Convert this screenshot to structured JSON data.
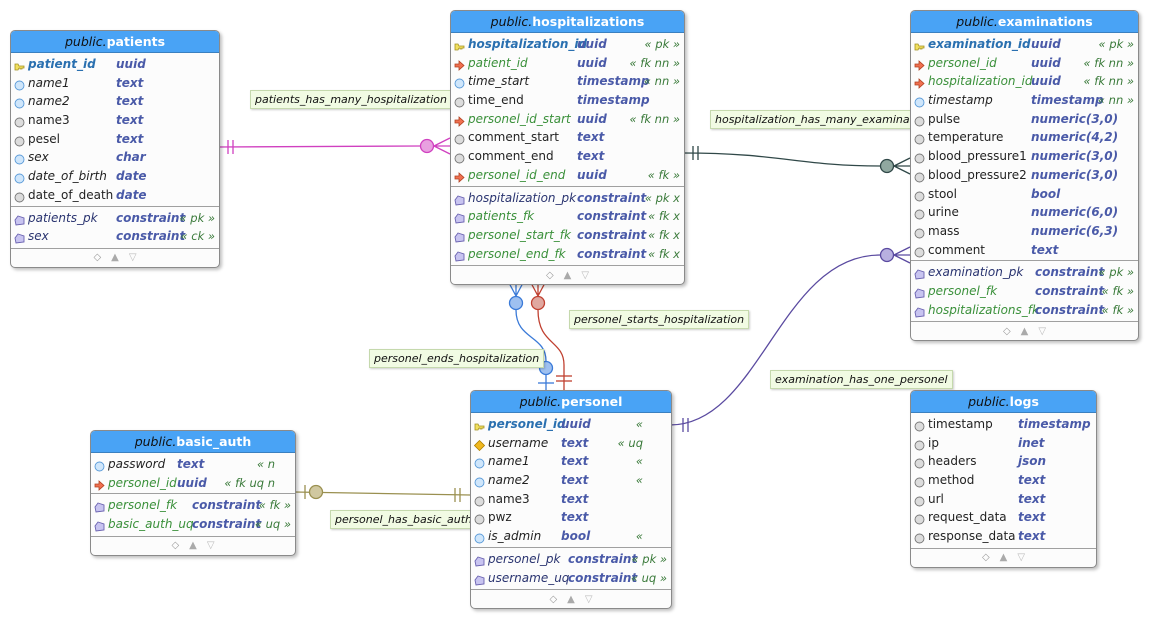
{
  "colors": {
    "header": "#49a3f5",
    "patients_rel": "#d040c0",
    "exam_hosp_rel": "#304848",
    "exam_personel_rel": "#5a4aa0",
    "basic_auth_rel": "#9a9050",
    "ends_rel": "#3a7ad8",
    "starts_rel": "#c04030"
  },
  "tables": [
    {
      "id": "patients",
      "schema": "public.",
      "name": "patients",
      "columns": [
        {
          "name": "patient_id",
          "type": "uuid",
          "tag": "",
          "kind": "pk",
          "icon": "key-icon"
        },
        {
          "name": "name1",
          "type": "text",
          "tag": "",
          "kind": "nn",
          "icon": "mandatory-circle-icon"
        },
        {
          "name": "name2",
          "type": "text",
          "tag": "",
          "kind": "nn",
          "icon": "mandatory-circle-icon"
        },
        {
          "name": "name3",
          "type": "text",
          "tag": "",
          "kind": "rg",
          "icon": "optional-circle-icon"
        },
        {
          "name": "pesel",
          "type": "text",
          "tag": "",
          "kind": "rg",
          "icon": "optional-circle-icon"
        },
        {
          "name": "sex",
          "type": "char",
          "tag": "",
          "kind": "nn",
          "icon": "mandatory-circle-icon"
        },
        {
          "name": "date_of_birth",
          "type": "date",
          "tag": "",
          "kind": "nn",
          "icon": "mandatory-circle-icon"
        },
        {
          "name": "date_of_death",
          "type": "date",
          "tag": "",
          "kind": "rg",
          "icon": "optional-circle-icon"
        }
      ],
      "constraints": [
        {
          "name": "patients_pk",
          "type": "constraint",
          "tag": "« pk »",
          "kind": "cs"
        },
        {
          "name": "sex",
          "type": "constraint",
          "tag": "« ck »",
          "kind": "cs"
        }
      ]
    },
    {
      "id": "hospitalizations",
      "schema": "public.",
      "name": "hospitalizations",
      "columns": [
        {
          "name": "hospitalization_id",
          "type": "uuid",
          "tag": "« pk »",
          "kind": "pk",
          "icon": "key-icon"
        },
        {
          "name": "patient_id",
          "type": "uuid",
          "tag": "« fk nn »",
          "kind": "fk",
          "icon": "foreign-key-icon"
        },
        {
          "name": "time_start",
          "type": "timestamp",
          "tag": "« nn »",
          "kind": "nn",
          "icon": "mandatory-circle-icon"
        },
        {
          "name": "time_end",
          "type": "timestamp",
          "tag": "",
          "kind": "rg",
          "icon": "optional-circle-icon"
        },
        {
          "name": "personel_id_start",
          "type": "uuid",
          "tag": "« fk nn »",
          "kind": "fk",
          "icon": "foreign-key-icon"
        },
        {
          "name": "comment_start",
          "type": "text",
          "tag": "",
          "kind": "rg",
          "icon": "optional-circle-icon"
        },
        {
          "name": "comment_end",
          "type": "text",
          "tag": "",
          "kind": "rg",
          "icon": "optional-circle-icon"
        },
        {
          "name": "personel_id_end",
          "type": "uuid",
          "tag": "« fk »",
          "kind": "fk",
          "icon": "foreign-key-icon"
        }
      ],
      "constraints": [
        {
          "name": "hospitalization_pk",
          "type": "constraint",
          "tag": "« pk x",
          "kind": "cs"
        },
        {
          "name": "patients_fk",
          "type": "constraint",
          "tag": "« fk x",
          "kind": "fk"
        },
        {
          "name": "personel_start_fk",
          "type": "constraint",
          "tag": "« fk x",
          "kind": "fk"
        },
        {
          "name": "personel_end_fk",
          "type": "constraint",
          "tag": "« fk x",
          "kind": "fk"
        }
      ]
    },
    {
      "id": "examinations",
      "schema": "public.",
      "name": "examinations",
      "columns": [
        {
          "name": "examination_id",
          "type": "uuid",
          "tag": "« pk »",
          "kind": "pk",
          "icon": "key-icon"
        },
        {
          "name": "personel_id",
          "type": "uuid",
          "tag": "« fk nn »",
          "kind": "fk",
          "icon": "foreign-key-icon"
        },
        {
          "name": "hospitalization_id",
          "type": "uuid",
          "tag": "« fk nn »",
          "kind": "fk",
          "icon": "foreign-key-icon"
        },
        {
          "name": "timestamp",
          "type": "timestamp",
          "tag": "« nn »",
          "kind": "nn",
          "icon": "mandatory-circle-icon"
        },
        {
          "name": "pulse",
          "type": "numeric(3,0)",
          "tag": "",
          "kind": "rg",
          "icon": "optional-circle-icon"
        },
        {
          "name": "temperature",
          "type": "numeric(4,2)",
          "tag": "",
          "kind": "rg",
          "icon": "optional-circle-icon"
        },
        {
          "name": "blood_pressure1",
          "type": "numeric(3,0)",
          "tag": "",
          "kind": "rg",
          "icon": "optional-circle-icon"
        },
        {
          "name": "blood_pressure2",
          "type": "numeric(3,0)",
          "tag": "",
          "kind": "rg",
          "icon": "optional-circle-icon"
        },
        {
          "name": "stool",
          "type": "bool",
          "tag": "",
          "kind": "rg",
          "icon": "optional-circle-icon"
        },
        {
          "name": "urine",
          "type": "numeric(6,0)",
          "tag": "",
          "kind": "rg",
          "icon": "optional-circle-icon"
        },
        {
          "name": "mass",
          "type": "numeric(6,3)",
          "tag": "",
          "kind": "rg",
          "icon": "optional-circle-icon"
        },
        {
          "name": "comment",
          "type": "text",
          "tag": "",
          "kind": "rg",
          "icon": "optional-circle-icon"
        }
      ],
      "constraints": [
        {
          "name": "examination_pk",
          "type": "constraint",
          "tag": "« pk »",
          "kind": "cs"
        },
        {
          "name": "personel_fk",
          "type": "constraint",
          "tag": "« fk »",
          "kind": "fk"
        },
        {
          "name": "hospitalizations_fk",
          "type": "constraint",
          "tag": "« fk »",
          "kind": "fk"
        }
      ]
    },
    {
      "id": "personel",
      "schema": "public.",
      "name": "personel",
      "columns": [
        {
          "name": "personel_id",
          "type": "uuid",
          "tag": "«",
          "kind": "pk",
          "icon": "key-icon"
        },
        {
          "name": "username",
          "type": "text",
          "tag": "« uq",
          "kind": "nn",
          "icon": "unique-diamond-icon"
        },
        {
          "name": "name1",
          "type": "text",
          "tag": "«",
          "kind": "nn",
          "icon": "mandatory-circle-icon"
        },
        {
          "name": "name2",
          "type": "text",
          "tag": "«",
          "kind": "nn",
          "icon": "mandatory-circle-icon"
        },
        {
          "name": "name3",
          "type": "text",
          "tag": "",
          "kind": "rg",
          "icon": "optional-circle-icon"
        },
        {
          "name": "pwz",
          "type": "text",
          "tag": "",
          "kind": "rg",
          "icon": "optional-circle-icon"
        },
        {
          "name": "is_admin",
          "type": "bool",
          "tag": "«",
          "kind": "nn",
          "icon": "mandatory-circle-icon"
        }
      ],
      "constraints": [
        {
          "name": "personel_pk",
          "type": "constraint",
          "tag": "« pk »",
          "kind": "cs"
        },
        {
          "name": "username_uq",
          "type": "constraint",
          "tag": "« uq »",
          "kind": "cs"
        }
      ]
    },
    {
      "id": "basic_auth",
      "schema": "public.",
      "name": "basic_auth",
      "columns": [
        {
          "name": "password",
          "type": "text",
          "tag": "« n",
          "kind": "nn",
          "icon": "mandatory-circle-icon"
        },
        {
          "name": "personel_id",
          "type": "uuid",
          "tag": "« fk uq n",
          "kind": "fk",
          "icon": "foreign-key-icon"
        }
      ],
      "constraints": [
        {
          "name": "personel_fk",
          "type": "constraint",
          "tag": "« fk »",
          "kind": "fk"
        },
        {
          "name": "basic_auth_uq",
          "type": "constraint",
          "tag": "« uq »",
          "kind": "fk"
        }
      ]
    },
    {
      "id": "logs",
      "schema": "public.",
      "name": "logs",
      "columns": [
        {
          "name": "timestamp",
          "type": "timestamp",
          "tag": "",
          "kind": "rg",
          "icon": "optional-circle-icon"
        },
        {
          "name": "ip",
          "type": "inet",
          "tag": "",
          "kind": "rg",
          "icon": "optional-circle-icon"
        },
        {
          "name": "headers",
          "type": "json",
          "tag": "",
          "kind": "rg",
          "icon": "optional-circle-icon"
        },
        {
          "name": "method",
          "type": "text",
          "tag": "",
          "kind": "rg",
          "icon": "optional-circle-icon"
        },
        {
          "name": "url",
          "type": "text",
          "tag": "",
          "kind": "rg",
          "icon": "optional-circle-icon"
        },
        {
          "name": "request_data",
          "type": "text",
          "tag": "",
          "kind": "rg",
          "icon": "optional-circle-icon"
        },
        {
          "name": "response_data",
          "type": "text",
          "tag": "",
          "kind": "rg",
          "icon": "optional-circle-icon"
        }
      ],
      "constraints": []
    }
  ],
  "relations": {
    "patients_has_many_hospitalization": "patients_has_many_hospitalization",
    "hospitalization_has_many_examination": "hospitalization_has_many_examination",
    "personel_starts_hospitalization": "personel_starts_hospitalization",
    "personel_ends_hospitalization": "personel_ends_hospitalization",
    "examination_has_one_personel": "examination_has_one_personel",
    "personel_has_basic_auth": "personel_has_basic_auth"
  }
}
